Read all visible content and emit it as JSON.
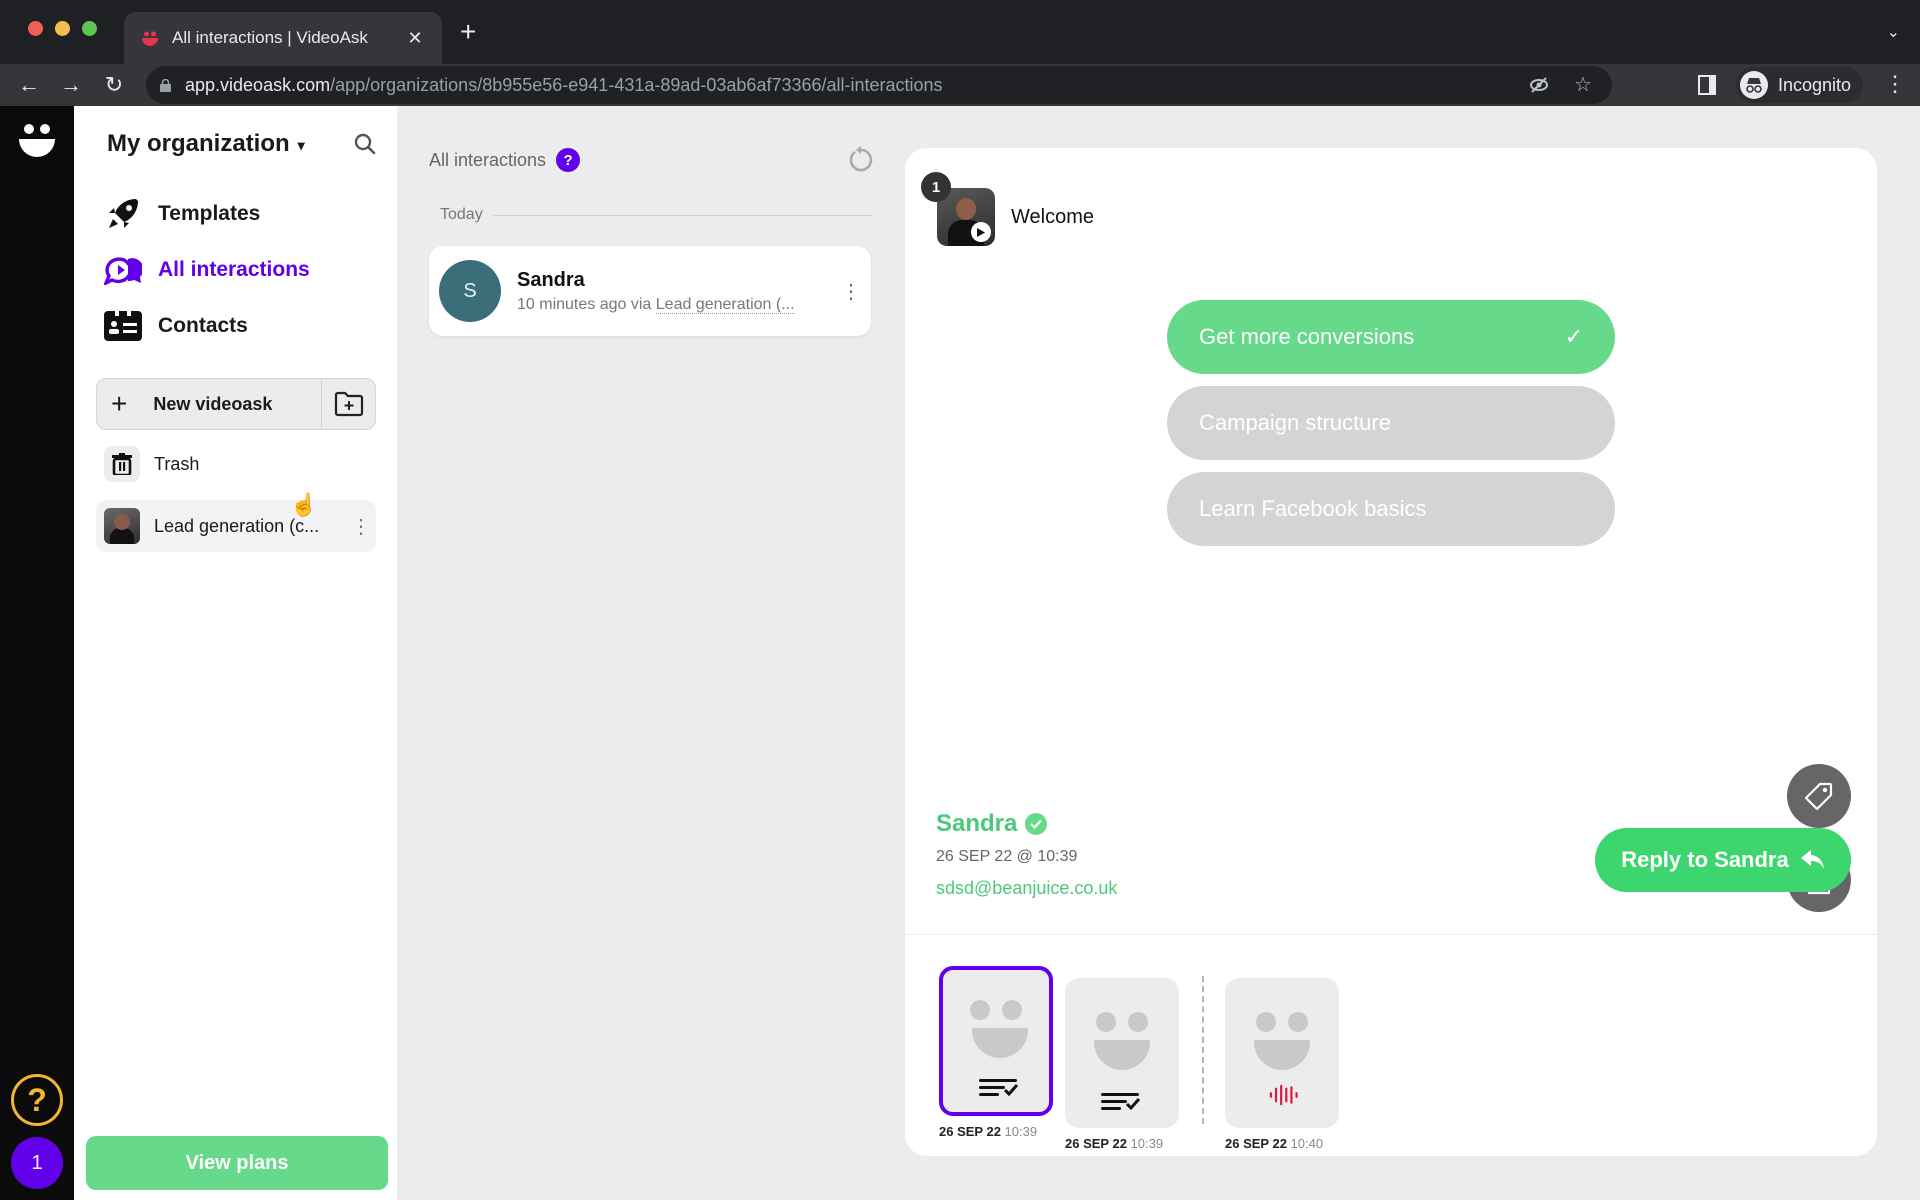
{
  "browser": {
    "tab_title": "All interactions | VideoAsk",
    "url_host": "app.videoask.com",
    "url_path": "/app/organizations/8b955e56-e941-431a-89ad-03ab6af73366/all-interactions",
    "profile_label": "Incognito"
  },
  "rail": {
    "help_label": "?",
    "notification_count": "1"
  },
  "sidebar": {
    "org_name": "My organization",
    "nav": [
      {
        "label": "Templates",
        "icon": "rocket-icon",
        "active": false
      },
      {
        "label": "All interactions",
        "icon": "interactions-icon",
        "active": true
      },
      {
        "label": "Contacts",
        "icon": "contacts-icon",
        "active": false
      }
    ],
    "new_videoask_label": "New videoask",
    "trash_label": "Trash",
    "videoasks": [
      {
        "label": "Lead generation (c..."
      }
    ],
    "view_plans_label": "View plans"
  },
  "list": {
    "title": "All interactions",
    "help_badge": "?",
    "group_label": "Today",
    "items": [
      {
        "initial": "S",
        "name": "Sandra",
        "time": "10 minutes ago via",
        "source": "Lead generation (..."
      }
    ]
  },
  "detail": {
    "step_number": "1",
    "step_title": "Welcome",
    "options": [
      {
        "label": "Get more conversions",
        "selected": true
      },
      {
        "label": "Campaign structure",
        "selected": false
      },
      {
        "label": "Learn Facebook basics",
        "selected": false
      }
    ],
    "respondent": {
      "name": "Sandra",
      "date": "26 SEP 22 @ 10:39",
      "email": "sdsd@beanjuice.co.uk"
    },
    "reply_label": "Reply to Sandra",
    "thumbnails": [
      {
        "date": "26 SEP 22",
        "time": "10:39",
        "type": "multiple-choice",
        "selected": true
      },
      {
        "date": "26 SEP 22",
        "time": "10:39",
        "type": "multiple-choice",
        "selected": false
      },
      {
        "date": "26 SEP 22",
        "time": "10:40",
        "type": "audio",
        "selected": false
      }
    ]
  },
  "colors": {
    "accent_purple": "#6200ea",
    "green": "#66d98b",
    "reply_green": "#3dd56d",
    "audio_red": "#d81b46",
    "help_yellow": "#f3b632"
  }
}
